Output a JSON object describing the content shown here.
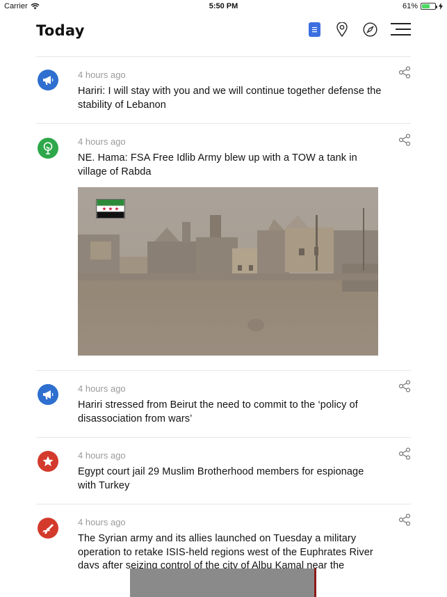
{
  "status": {
    "carrier": "Carrier",
    "time": "5:50 PM",
    "battery": "61%",
    "battery_level": 0.61
  },
  "header": {
    "title": "Today",
    "icons": [
      "list-icon",
      "location-pin-icon",
      "compass-icon",
      "menu-icon"
    ]
  },
  "feed": [
    {
      "type": "megaphone",
      "time": "4 hours ago",
      "headline": "Hariri: I will stay with you and we will continue together defense the stability of Lebanon"
    },
    {
      "type": "tree",
      "time": "4 hours ago",
      "headline": "NE. Hama: FSA Free Idlib Army blew up with a TOW a tank in village of Rabda"
    },
    {
      "type": "megaphone",
      "time": "4 hours ago",
      "headline": "Hariri stressed from Beirut the need to commit to the ‘policy of disassociation from wars’"
    },
    {
      "type": "star",
      "time": "4 hours ago",
      "headline": "Egypt court jail 29 Muslim Brotherhood members for espionage with Turkey"
    },
    {
      "type": "rifle",
      "time": "4 hours ago",
      "headline": "The Syrian army and its allies launched on Tuesday a military operation to retake ISIS-held regions west of the Euphrates River days after seizing control of the city of Albu Kamal near the"
    }
  ],
  "colors": {
    "accent": "#3b6fe0",
    "blue": "#2e6fcf",
    "green": "#2ea84a",
    "red": "#d33a2c"
  }
}
